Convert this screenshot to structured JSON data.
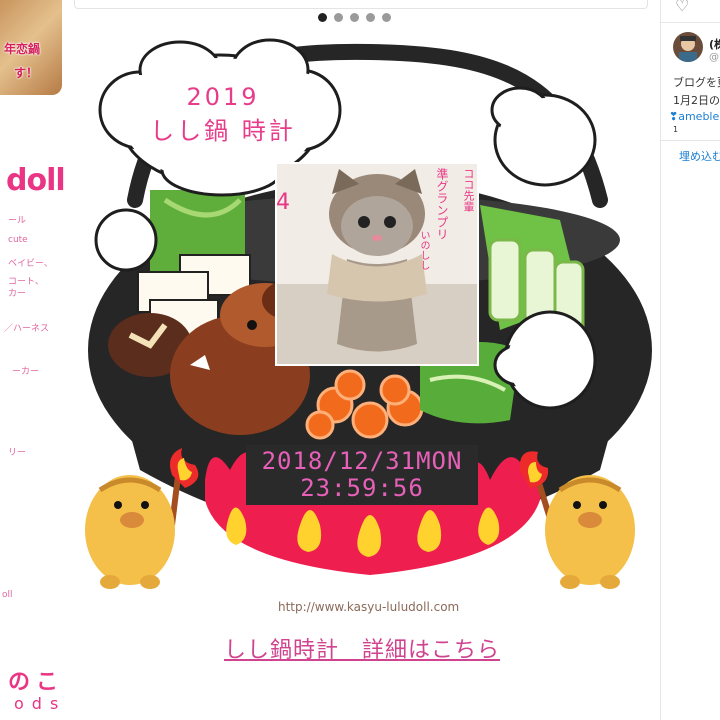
{
  "left_sidebar": {
    "thumb_text_1": "年恋鍋",
    "thumb_text_2": "す！",
    "logo": "doll",
    "nav": [
      "ール",
      "cute",
      "ベイビー、",
      "コート、",
      "カー",
      "／ハーネス",
      "ーカー",
      "リー",
      "oll"
    ],
    "footer_1": "のこ",
    "footer_2": "ods"
  },
  "carousel": {
    "dots": 5,
    "active_index": 0
  },
  "clock": {
    "title_line1": "2019",
    "title_line2": "しし鍋 時計",
    "photo": {
      "number": "4",
      "rank": "準グランプリ",
      "name": "ココ先輩",
      "caption": "いのしし"
    },
    "date": "2018/12/31MON",
    "time": "23:59:56",
    "url": "http://www.kasyu-luludoll.com",
    "detail_link": "しし鍋時計　詳細はこちら"
  },
  "right_sidebar": {
    "name": "(株",
    "handle": "@",
    "text_1": "ブログを更",
    "text_2": "1月2日の",
    "link": "❣ameble",
    "count": "1",
    "embed": "埋め込む"
  },
  "colors": {
    "accent_pink": "#ea3585",
    "clock_text": "#e660b8",
    "pot_black": "#262626",
    "flame_red": "#ee1f4f",
    "flame_yellow": "#ffd22e",
    "boar_brown": "#8b3e1f"
  }
}
